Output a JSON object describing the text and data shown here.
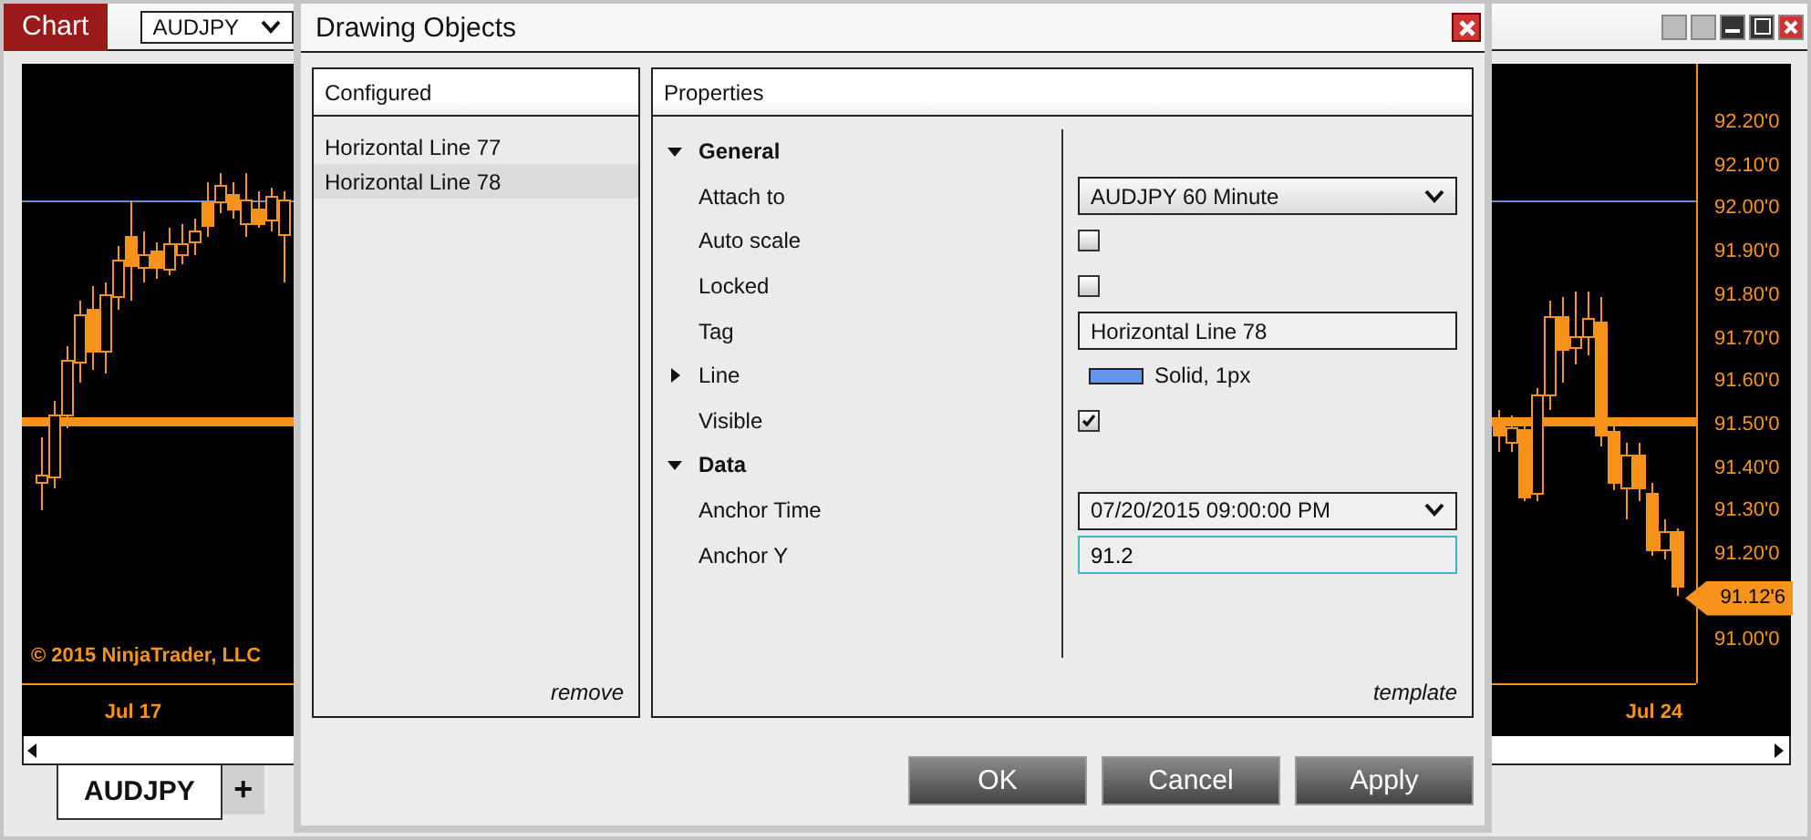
{
  "chart_window": {
    "title": "Chart",
    "instrument": "AUDJPY",
    "price_axis": [
      {
        "kind": "tick",
        "label": "92.20'0"
      },
      {
        "kind": "tick",
        "label": "92.10'0"
      },
      {
        "kind": "tick",
        "label": "92.00'0"
      },
      {
        "kind": "tick",
        "label": "91.90'0"
      },
      {
        "kind": "tick",
        "label": "91.80'0"
      },
      {
        "kind": "tick",
        "label": "91.70'0"
      },
      {
        "kind": "tick",
        "label": "91.60'0"
      },
      {
        "kind": "tick",
        "label": "91.50'0"
      },
      {
        "kind": "tick",
        "label": "91.40'0"
      },
      {
        "kind": "tick",
        "label": "91.30'0"
      },
      {
        "kind": "tick",
        "label": "91.20'0"
      },
      {
        "kind": "current",
        "label": "91.12'6"
      },
      {
        "kind": "tick",
        "label": "91.00'0"
      }
    ],
    "copyright": "© 2015 NinjaTrader, LLC",
    "time_labels": [
      "Jul 17",
      "Jul 24"
    ],
    "tabs": [
      {
        "label": "AUDJPY",
        "selected": true
      }
    ],
    "add_tab": "+"
  },
  "dialog": {
    "title": "Drawing Objects",
    "configured": {
      "title": "Configured",
      "items": [
        {
          "label": "Horizontal Line 77",
          "selected": false
        },
        {
          "label": "Horizontal Line 78",
          "selected": true
        }
      ],
      "action": "remove"
    },
    "properties": {
      "title": "Properties",
      "rows": [
        {
          "kind": "group",
          "label": "General",
          "expanded": true
        },
        {
          "kind": "select",
          "label": "Attach to",
          "value": "AUDJPY 60 Minute"
        },
        {
          "kind": "checkbox",
          "label": "Auto scale",
          "checked": false
        },
        {
          "kind": "checkbox",
          "label": "Locked",
          "checked": false
        },
        {
          "kind": "text",
          "label": "Tag",
          "value": "Horizontal Line 78"
        },
        {
          "kind": "stroke",
          "label": "Line",
          "expanded": false,
          "value": "Solid, 1px"
        },
        {
          "kind": "checkbox",
          "label": "Visible",
          "checked": true
        },
        {
          "kind": "group",
          "label": "Data",
          "expanded": true
        },
        {
          "kind": "select",
          "label": "Anchor Time",
          "value": "07/20/2015 09:00:00 PM"
        },
        {
          "kind": "input",
          "label": "Anchor Y",
          "value": "91.2",
          "focused": true
        }
      ],
      "action": "template"
    },
    "buttons": [
      "OK",
      "Cancel",
      "Apply"
    ]
  }
}
